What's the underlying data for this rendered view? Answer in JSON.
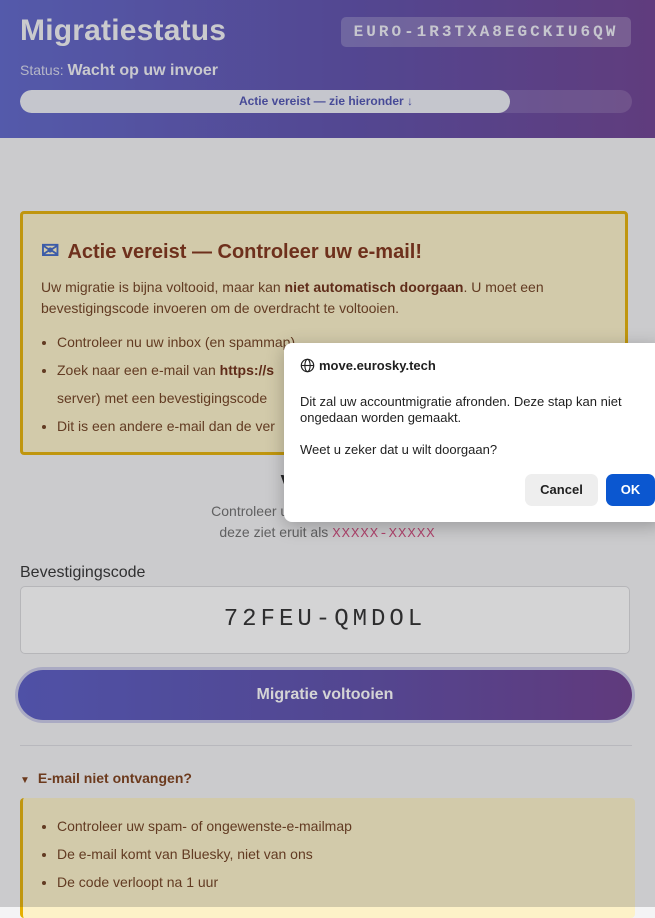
{
  "header": {
    "title": "Migratiestatus",
    "migration_id": "EURO-1R3TXA8EGCKIU6QW",
    "status_label": "Status:",
    "status_value": "Wacht op uw invoer",
    "progress_label": "Actie vereist — zie hieronder ↓",
    "progress_fraction": 0.8
  },
  "alert": {
    "icon": "envelope-icon",
    "title": "Actie vereist — Controleer uw e-mail!",
    "p_start": "Uw migratie is bijna voltooid, maar kan ",
    "p_bold": "niet automatisch doorgaan",
    "p_end": ". U moet een bevestigingscode invoeren om de overdracht te voltooien.",
    "items": [
      "Controleer nu uw inbox (en spammap)",
      "Zoek naar een e-mail van ",
      "server) met een bevestigingscode",
      "Dit is een andere e-mail dan de ver"
    ],
    "item2_bold": "https://s"
  },
  "code_section": {
    "heading": "Voer uw b",
    "help_line1": "Controleer uw e-mail voor een code v",
    "help_line2": "deze ziet eruit als ",
    "format_example": "XXXXX-XXXXX",
    "field_label": "Bevestigingscode",
    "field_value": "72FEU-QMDOL",
    "submit_label": "Migratie voltooien"
  },
  "details": {
    "summary": "E-mail niet ontvangen?",
    "items": [
      "Controleer uw spam- of ongewenste-e-mailmap",
      "De e-mail komt van Bluesky, niet van ons",
      "De code verloopt na 1 uur"
    ]
  },
  "dialog": {
    "origin": "move.eurosky.tech",
    "message": "Dit zal uw accountmigratie afronden. Deze stap kan niet ongedaan worden gemaakt.",
    "question": "Weet u zeker dat u wilt doorgaan?",
    "cancel_label": "Cancel",
    "ok_label": "OK"
  },
  "colors": {
    "accent": "#5a4aa8",
    "warning_border": "#e6b000",
    "warning_bg": "#fdf2c8",
    "dialog_ok": "#0b57d0"
  }
}
